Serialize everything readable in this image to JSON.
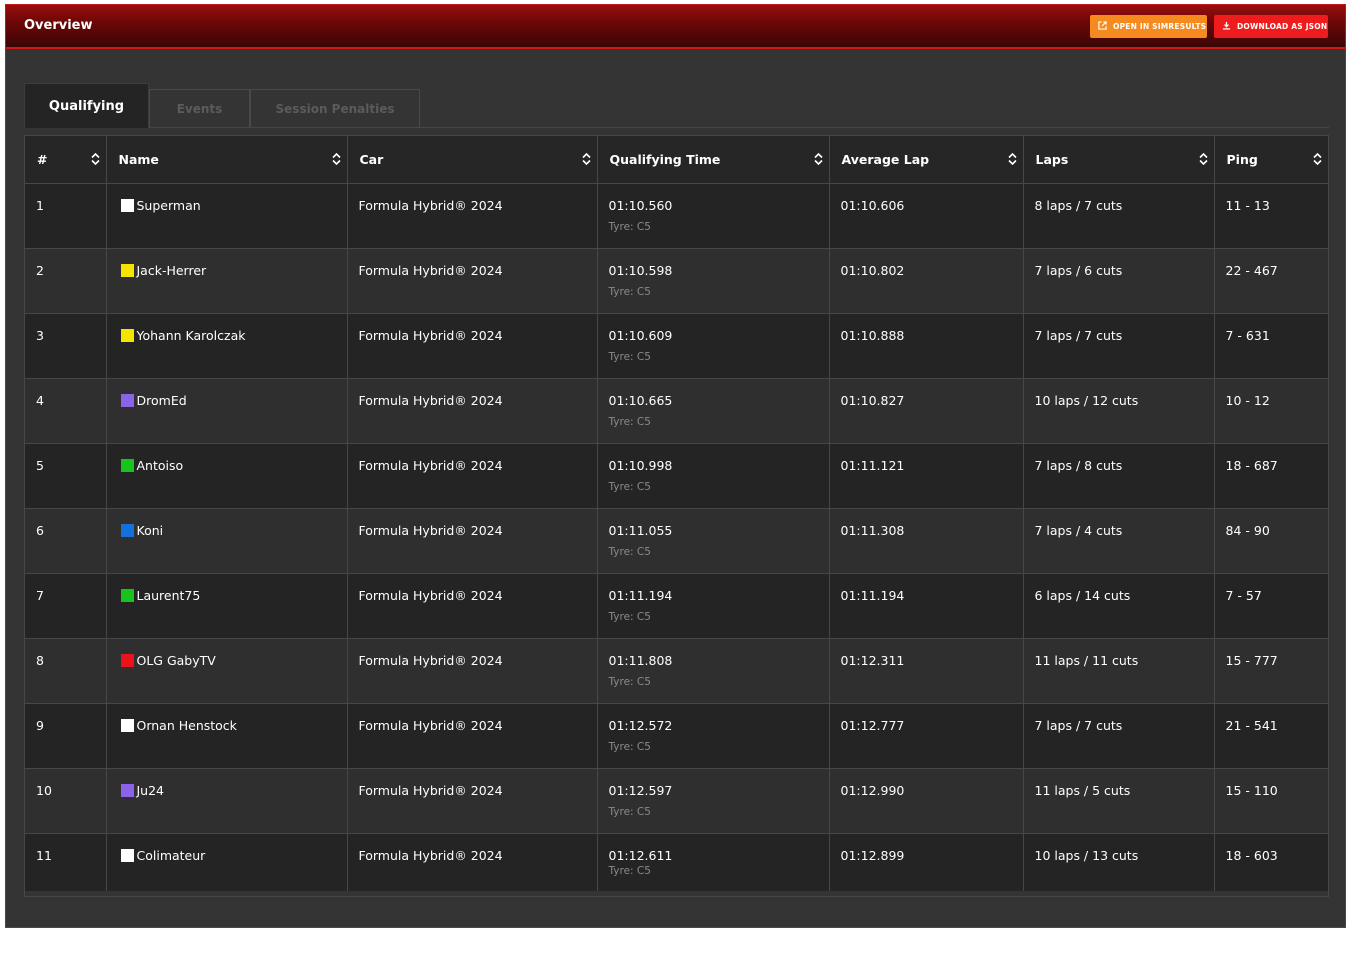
{
  "header": {
    "title": "Overview",
    "open_button": "OPEN IN SIMRESULTS",
    "download_button": "DOWNLOAD AS JSON",
    "open_icon": "external-link-icon",
    "download_icon": "download-icon"
  },
  "tabs": [
    {
      "label": "Qualifying",
      "active": true
    },
    {
      "label": "Events",
      "active": false
    },
    {
      "label": "Session Penalties",
      "active": false
    }
  ],
  "columns": [
    "#",
    "Name",
    "Car",
    "Qualifying Time",
    "Average Lap",
    "Laps",
    "Ping"
  ],
  "rows": [
    {
      "pos": "1",
      "name": "Superman",
      "color": "#ffffff",
      "car": "Formula Hybrid® 2024",
      "time": "01:10.560",
      "tyre": "Tyre: C5",
      "avg": "01:10.606",
      "laps": "8 laps / 7 cuts",
      "ping": "11 - 13"
    },
    {
      "pos": "2",
      "name": "Jack-Herrer",
      "color": "#f5e400",
      "car": "Formula Hybrid® 2024",
      "time": "01:10.598",
      "tyre": "Tyre: C5",
      "avg": "01:10.802",
      "laps": "7 laps / 6 cuts",
      "ping": "22 - 467"
    },
    {
      "pos": "3",
      "name": "Yohann Karolczak",
      "color": "#f5e400",
      "car": "Formula Hybrid® 2024",
      "time": "01:10.609",
      "tyre": "Tyre: C5",
      "avg": "01:10.888",
      "laps": "7 laps / 7 cuts",
      "ping": "7 - 631"
    },
    {
      "pos": "4",
      "name": "DromEd",
      "color": "#8a63e8",
      "car": "Formula Hybrid® 2024",
      "time": "01:10.665",
      "tyre": "Tyre: C5",
      "avg": "01:10.827",
      "laps": "10 laps / 12 cuts",
      "ping": "10 - 12"
    },
    {
      "pos": "5",
      "name": "Antoiso",
      "color": "#17c41b",
      "car": "Formula Hybrid® 2024",
      "time": "01:10.998",
      "tyre": "Tyre: C5",
      "avg": "01:11.121",
      "laps": "7 laps / 8 cuts",
      "ping": "18 - 687"
    },
    {
      "pos": "6",
      "name": "Koni",
      "color": "#1570d8",
      "car": "Formula Hybrid® 2024",
      "time": "01:11.055",
      "tyre": "Tyre: C5",
      "avg": "01:11.308",
      "laps": "7 laps / 4 cuts",
      "ping": "84 - 90"
    },
    {
      "pos": "7",
      "name": "Laurent75",
      "color": "#17c41b",
      "car": "Formula Hybrid® 2024",
      "time": "01:11.194",
      "tyre": "Tyre: C5",
      "avg": "01:11.194",
      "laps": "6 laps / 14 cuts",
      "ping": "7 - 57"
    },
    {
      "pos": "8",
      "name": "OLG GabyTV",
      "color": "#e8131b",
      "car": "Formula Hybrid® 2024",
      "time": "01:11.808",
      "tyre": "Tyre: C5",
      "avg": "01:12.311",
      "laps": "11 laps / 11 cuts",
      "ping": "15 - 777"
    },
    {
      "pos": "9",
      "name": "Ornan Henstock",
      "color": "#ffffff",
      "car": "Formula Hybrid® 2024",
      "time": "01:12.572",
      "tyre": "Tyre: C5",
      "avg": "01:12.777",
      "laps": "7 laps / 7 cuts",
      "ping": "21 - 541"
    },
    {
      "pos": "10",
      "name": "Ju24",
      "color": "#8a63e8",
      "car": "Formula Hybrid® 2024",
      "time": "01:12.597",
      "tyre": "Tyre: C5",
      "avg": "01:12.990",
      "laps": "11 laps / 5 cuts",
      "ping": "15 - 110"
    },
    {
      "pos": "11",
      "name": "Colimateur",
      "color": "#ffffff",
      "car": "Formula Hybrid® 2024",
      "time": "01:12.611",
      "tyre": "Tyre: C5",
      "avg": "01:12.899",
      "laps": "10 laps / 13 cuts",
      "ping": "18 - 603"
    }
  ]
}
